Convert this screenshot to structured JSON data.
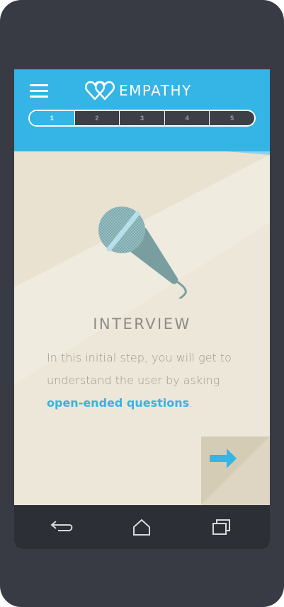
{
  "header": {
    "brand": "EMPATHY",
    "menu_icon": "hamburger-menu-icon",
    "logo_icon": "double-heart-logo-icon",
    "accent_color": "#35b4e6"
  },
  "steps": {
    "items": [
      "1",
      "2",
      "3",
      "4",
      "5"
    ],
    "active": "1"
  },
  "main": {
    "illustration_icon": "microphone-icon",
    "title": "INTERVIEW",
    "desc_pre": "In this initial step, you will get to understand the user by asking ",
    "desc_highlight": "open-ended questions",
    "desc_post": ".",
    "next_icon": "arrow-right-icon"
  },
  "navbar": {
    "back_icon": "back-icon",
    "home_icon": "home-icon",
    "recents_icon": "recent-apps-icon"
  }
}
